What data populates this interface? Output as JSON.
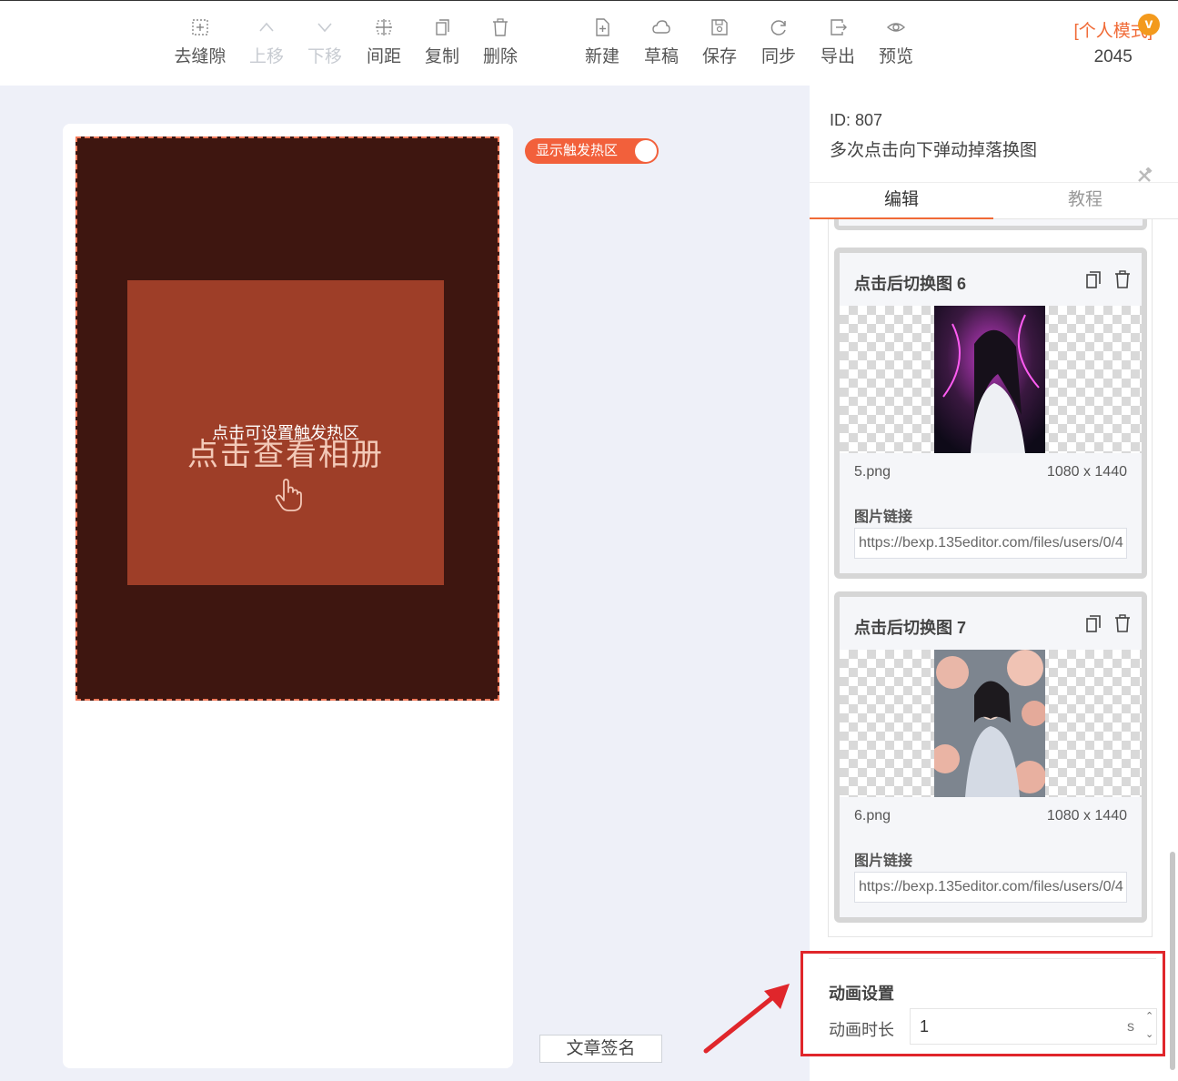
{
  "toolbar": {
    "items": [
      {
        "label": "去缝隙",
        "icon": "gap-remove-icon",
        "enabled": true
      },
      {
        "label": "上移",
        "icon": "chevron-up-icon",
        "enabled": false
      },
      {
        "label": "下移",
        "icon": "chevron-down-icon",
        "enabled": false
      },
      {
        "label": "间距",
        "icon": "spacing-icon",
        "enabled": true
      },
      {
        "label": "复制",
        "icon": "copy-icon",
        "enabled": true
      },
      {
        "label": "删除",
        "icon": "trash-icon",
        "enabled": true
      },
      {
        "label": "新建",
        "icon": "new-file-icon",
        "enabled": true
      },
      {
        "label": "草稿",
        "icon": "cloud-icon",
        "enabled": true
      },
      {
        "label": "保存",
        "icon": "save-icon",
        "enabled": true
      },
      {
        "label": "同步",
        "icon": "sync-icon",
        "enabled": true
      },
      {
        "label": "导出",
        "icon": "export-icon",
        "enabled": true
      },
      {
        "label": "预览",
        "icon": "eye-icon",
        "enabled": true
      }
    ],
    "mode_label": "[个人模式]",
    "mode_badge": "v",
    "mode_count": "2045"
  },
  "canvas": {
    "toggle_label": "显示触发热区",
    "toggle_on": true,
    "hotzone_caption": "点击可设置触发热区",
    "album_title": "点击查看相册",
    "sign_button": "文章签名"
  },
  "panel": {
    "id_text": "ID: 807",
    "title": "多次点击向下弹动掉落换图",
    "tabs": [
      {
        "label": "编辑",
        "active": true
      },
      {
        "label": "教程",
        "active": false
      }
    ],
    "items": [
      {
        "title": "点击后切换图 6",
        "file_name": "5.png",
        "file_size": "1080 x 1440",
        "link_label": "图片链接",
        "link_value": "https://bexp.135editor.com/files/users/0/4"
      },
      {
        "title": "点击后切换图 7",
        "file_name": "6.png",
        "file_size": "1080 x 1440",
        "link_label": "图片链接",
        "link_value": "https://bexp.135editor.com/files/users/0/4"
      }
    ],
    "animation": {
      "title": "动画设置",
      "duration_label": "动画时长",
      "duration_value": "1",
      "unit": "s"
    }
  },
  "colors": {
    "accent": "#f06a36",
    "poster_bg": "#3e1610",
    "card_bg": "#9e3e28",
    "highlight_red": "#e0262b"
  }
}
